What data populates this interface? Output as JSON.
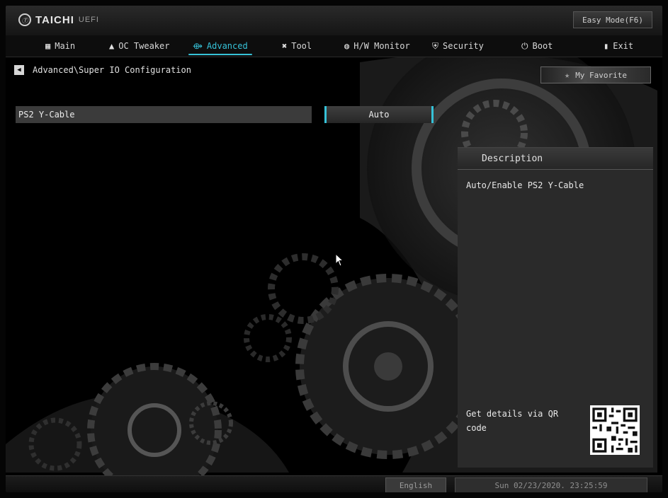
{
  "header": {
    "brand": "TAICHI",
    "brand_sub": "UEFI",
    "easy_mode": "Easy Mode(F6)"
  },
  "nav": {
    "tabs": [
      {
        "label": "Main",
        "icon": "grid-icon"
      },
      {
        "label": "OC Tweaker",
        "icon": "rocket-icon"
      },
      {
        "label": "Advanced",
        "icon": "advanced-icon",
        "active": true
      },
      {
        "label": "Tool",
        "icon": "tool-icon"
      },
      {
        "label": "H/W Monitor",
        "icon": "monitor-icon"
      },
      {
        "label": "Security",
        "icon": "shield-icon"
      },
      {
        "label": "Boot",
        "icon": "power-icon"
      },
      {
        "label": "Exit",
        "icon": "exit-icon"
      }
    ]
  },
  "breadcrumb": "Advanced\\Super IO Configuration",
  "favorite": "My Favorite",
  "settings": [
    {
      "label": "PS2 Y-Cable",
      "value": "Auto"
    }
  ],
  "description": {
    "title": "Description",
    "text": "Auto/Enable PS2 Y-Cable",
    "qr_text": "Get details via QR code"
  },
  "footer": {
    "language": "English",
    "datetime": "Sun 02/23/2020. 23:25:59"
  },
  "colors": {
    "accent": "#36c2d8",
    "panel": "#2a2a2a",
    "background": "#000000"
  }
}
